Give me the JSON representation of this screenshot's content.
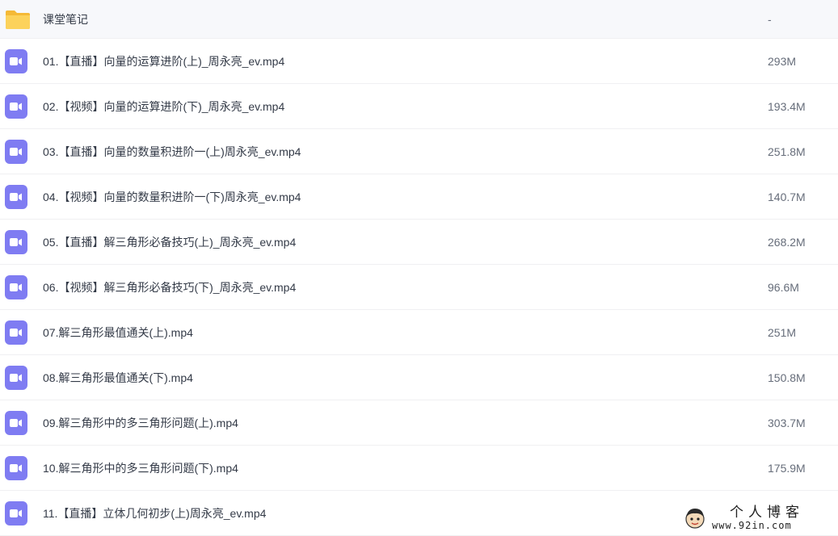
{
  "files": [
    {
      "type": "folder",
      "icon": "folder-icon",
      "name": "课堂笔记",
      "size": "-"
    },
    {
      "type": "video",
      "icon": "video-icon",
      "name": "01.【直播】向量的运算进阶(上)_周永亮_ev.mp4",
      "size": "293M"
    },
    {
      "type": "video",
      "icon": "video-icon",
      "name": "02.【视频】向量的运算进阶(下)_周永亮_ev.mp4",
      "size": "193.4M"
    },
    {
      "type": "video",
      "icon": "video-icon",
      "name": "03.【直播】向量的数量积进阶一(上)周永亮_ev.mp4",
      "size": "251.8M"
    },
    {
      "type": "video",
      "icon": "video-icon",
      "name": "04.【视频】向量的数量积进阶一(下)周永亮_ev.mp4",
      "size": "140.7M"
    },
    {
      "type": "video",
      "icon": "video-icon",
      "name": "05.【直播】解三角形必备技巧(上)_周永亮_ev.mp4",
      "size": "268.2M"
    },
    {
      "type": "video",
      "icon": "video-icon",
      "name": "06.【视频】解三角形必备技巧(下)_周永亮_ev.mp4",
      "size": "96.6M"
    },
    {
      "type": "video",
      "icon": "video-icon",
      "name": "07.解三角形最值通关(上).mp4",
      "size": "251M"
    },
    {
      "type": "video",
      "icon": "video-icon",
      "name": "08.解三角形最值通关(下).mp4",
      "size": "150.8M"
    },
    {
      "type": "video",
      "icon": "video-icon",
      "name": "09.解三角形中的多三角形问题(上).mp4",
      "size": "303.7M"
    },
    {
      "type": "video",
      "icon": "video-icon",
      "name": "10.解三角形中的多三角形问题(下).mp4",
      "size": "175.9M"
    },
    {
      "type": "video",
      "icon": "video-icon",
      "name": "11.【直播】立体几何初步(上)周永亮_ev.mp4",
      "size": ""
    }
  ],
  "watermark": {
    "title": "个人博客",
    "url": "www.92in.com"
  },
  "colors": {
    "video_icon_bg": "#7f7cf2",
    "folder_yellow": "#f7c948",
    "text": "#333a47",
    "size_text": "#666d7a"
  }
}
